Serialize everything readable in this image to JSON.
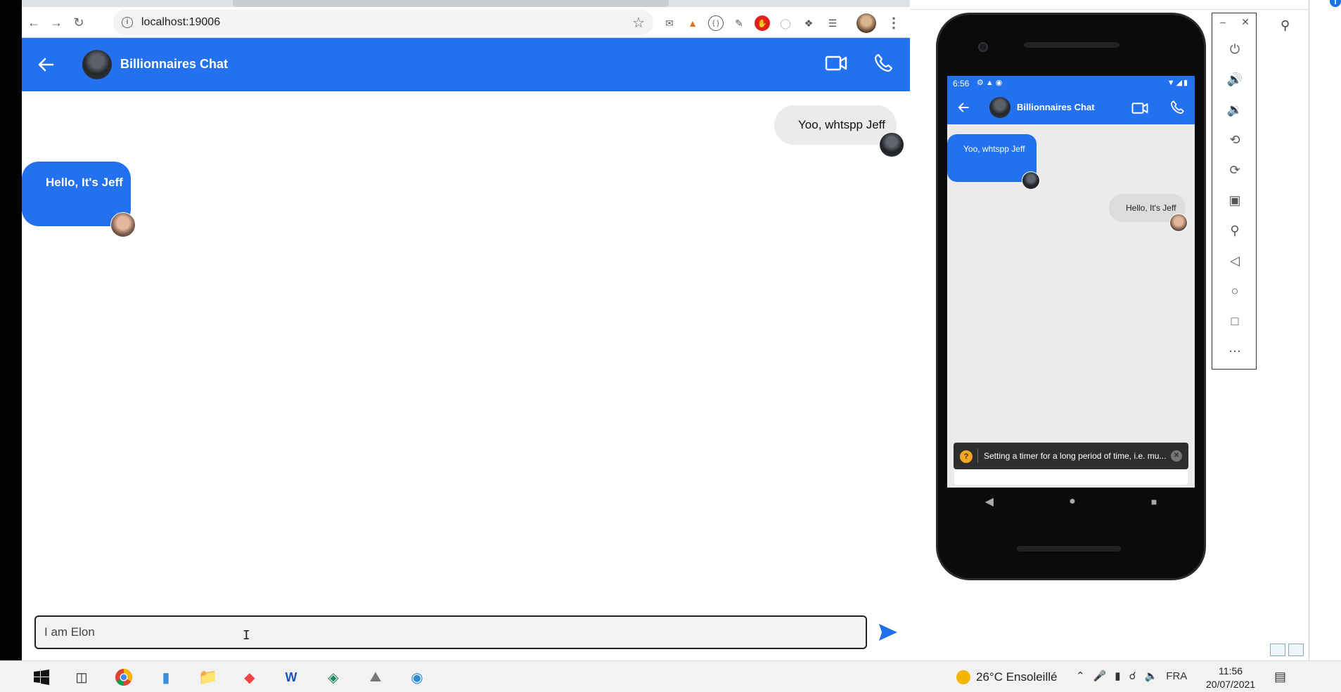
{
  "browser": {
    "url": "localhost:19006"
  },
  "chat": {
    "title": "Billionnaires Chat",
    "messages": [
      {
        "text": "Yoo, whtspp Jeff",
        "side": "right"
      },
      {
        "text": "Hello, It's Jeff",
        "side": "left"
      }
    ],
    "input_value": "I am Elon"
  },
  "phone": {
    "status_time": "6:56",
    "title": "Billionnaires Chat",
    "messages": [
      {
        "text": "Yoo, whtspp Jeff",
        "side": "left"
      },
      {
        "text": "Hello, It's Jeff",
        "side": "right"
      }
    ],
    "toast": "Setting a timer for a long period of time, i.e. mu..."
  },
  "emulator": {
    "tools": [
      "power-icon",
      "volume-up-icon",
      "volume-down-icon",
      "rotate-left-icon",
      "rotate-right-icon",
      "camera-icon",
      "zoom-icon",
      "back-icon",
      "home-icon",
      "overview-icon",
      "more-icon"
    ]
  },
  "taskbar": {
    "weather": "26°C Ensoleillé",
    "language": "FRA",
    "time": "11:56",
    "date": "20/07/2021"
  },
  "colors": {
    "accent": "#2471f0",
    "bubble_grey": "#ebebeb"
  }
}
